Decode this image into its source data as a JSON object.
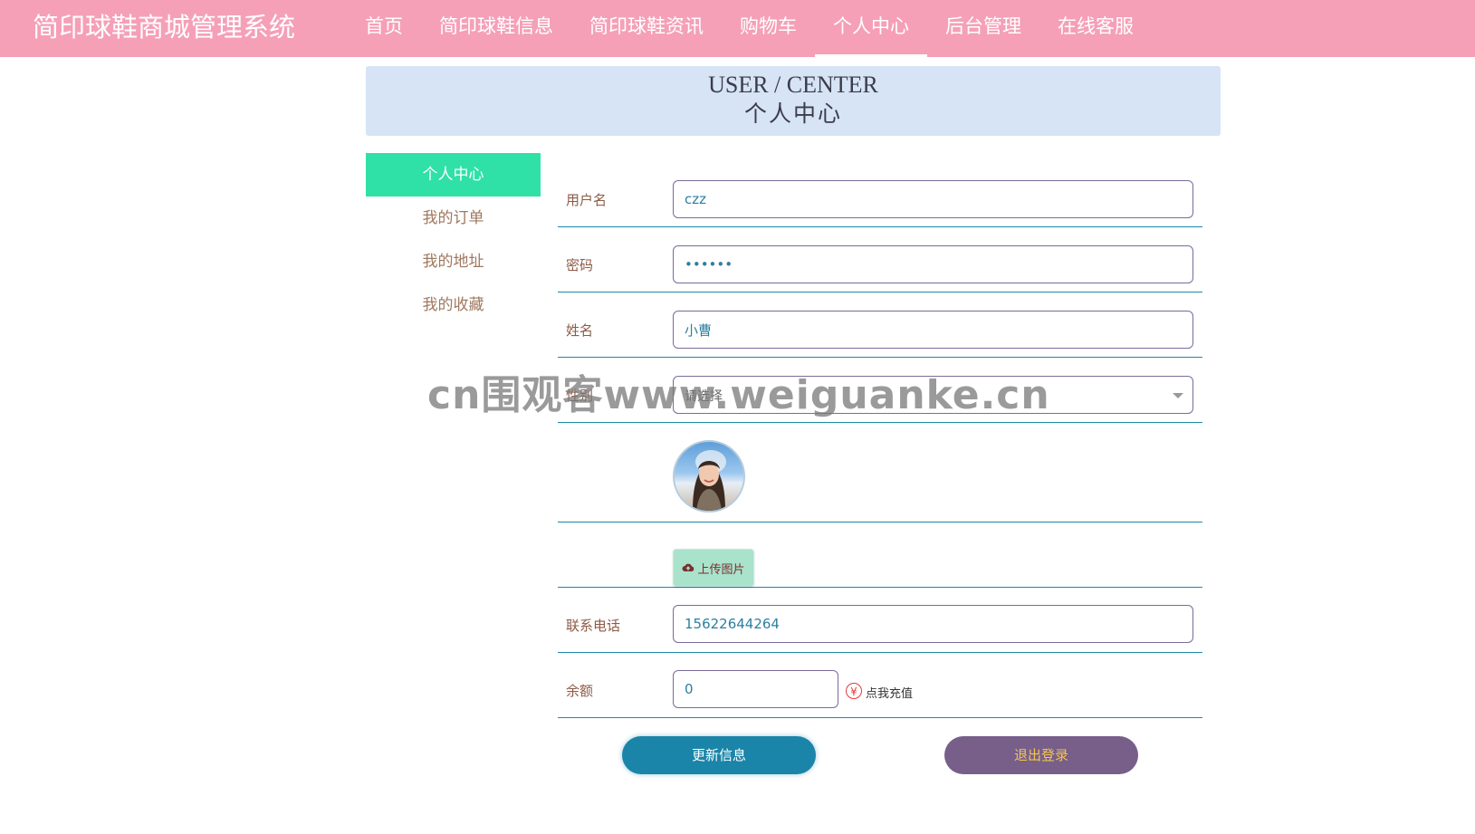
{
  "brand": "简印球鞋商城管理系统",
  "nav": {
    "items": [
      "首页",
      "简印球鞋信息",
      "简印球鞋资讯",
      "购物车",
      "个人中心",
      "后台管理",
      "在线客服"
    ],
    "active": "个人中心"
  },
  "banner": {
    "en": "USER / CENTER",
    "zh": "个人中心"
  },
  "side_menu": [
    "个人中心",
    "我的订单",
    "我的地址",
    "我的收藏"
  ],
  "form": {
    "username_label": "用户名",
    "username_value": "czz",
    "password_label": "密码",
    "password_value": "••••••",
    "name_label": "姓名",
    "name_value": "小曹",
    "gender_label": "性别",
    "gender_placeholder": "请选择",
    "upload_label": "上传图片",
    "phone_label": "联系电话",
    "phone_value": "15622644264",
    "balance_label": "余额",
    "balance_value": "0",
    "recharge_label": "点我充值",
    "update_button": "更新信息",
    "logout_button": "退出登录"
  },
  "watermark": "cn围观客www.weiguanke.cn",
  "colors": {
    "topbar": "#f5a0b7",
    "side_active": "#2fe1a6",
    "update": "#1a85a8",
    "logout": "#775f8a"
  }
}
